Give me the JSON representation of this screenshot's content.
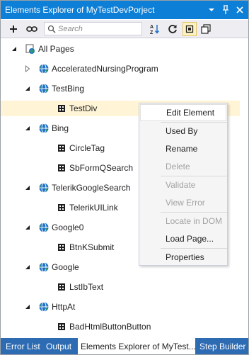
{
  "window": {
    "title": "Elements Explorer of MyTestDevPorject"
  },
  "titlebar_buttons": [
    "dropdown-icon",
    "pin-icon",
    "close-icon"
  ],
  "toolbar": {
    "search_placeholder": "Search",
    "icons": [
      "add-icon",
      "link-icon",
      "search-icon",
      "sort-az-icon",
      "refresh-icon",
      "single-view-icon",
      "multi-view-icon"
    ],
    "active_tool": "single-view-icon"
  },
  "tree": {
    "nodes": [
      {
        "label": "All Pages",
        "icon": "pages-icon",
        "expanded": true,
        "level": 0
      },
      {
        "label": "AcceleratedNursingProgram",
        "icon": "globe-icon",
        "expanded": false,
        "level": 1
      },
      {
        "label": "TestBing",
        "icon": "globe-icon",
        "expanded": true,
        "level": 1
      },
      {
        "label": "TestDiv",
        "icon": "element-icon",
        "level": 2,
        "selected": true
      },
      {
        "label": "Bing",
        "icon": "globe-icon",
        "expanded": true,
        "level": 1
      },
      {
        "label": "CircleTag",
        "icon": "element-icon",
        "level": 2
      },
      {
        "label": "SbFormQSearch",
        "icon": "element-icon",
        "level": 2
      },
      {
        "label": "TelerikGoogleSearch",
        "icon": "globe-icon",
        "expanded": true,
        "level": 1
      },
      {
        "label": "TelerikUILink",
        "icon": "element-icon",
        "level": 2
      },
      {
        "label": "Google0",
        "icon": "globe-icon",
        "expanded": true,
        "level": 1
      },
      {
        "label": "BtnKSubmit",
        "icon": "element-icon",
        "level": 2
      },
      {
        "label": "Google",
        "icon": "globe-icon",
        "expanded": true,
        "level": 1
      },
      {
        "label": "LstIbText",
        "icon": "element-icon",
        "level": 2
      },
      {
        "label": "HttpAt",
        "icon": "globe-icon",
        "expanded": true,
        "level": 1
      },
      {
        "label": "BadHtmlButtonButton",
        "icon": "element-icon",
        "level": 2
      }
    ]
  },
  "context_menu": {
    "items": [
      {
        "label": "Edit Element",
        "enabled": true,
        "highlighted": true
      },
      {
        "label": "Used By",
        "enabled": true
      },
      {
        "label": "Rename",
        "enabled": true
      },
      {
        "label": "Delete",
        "enabled": false
      },
      {
        "label": "Validate",
        "enabled": false
      },
      {
        "label": "View Error",
        "enabled": false
      },
      {
        "label": "Locate in DOM",
        "enabled": false
      },
      {
        "label": "Load Page...",
        "enabled": true
      },
      {
        "label": "Properties",
        "enabled": true
      }
    ]
  },
  "bottom_tabs": [
    {
      "label": "Error List",
      "active": false
    },
    {
      "label": "Output",
      "active": false
    },
    {
      "label": "Elements Explorer of MyTest...",
      "active": true
    },
    {
      "label": "Step Builder",
      "active": false
    }
  ],
  "colors": {
    "titlebar": "#0e7fd6",
    "tabs_bar": "#2d6bb3",
    "selection": "#fff4d6",
    "globe_blue": "#1e72c8",
    "globe_green": "#3aa64a"
  }
}
